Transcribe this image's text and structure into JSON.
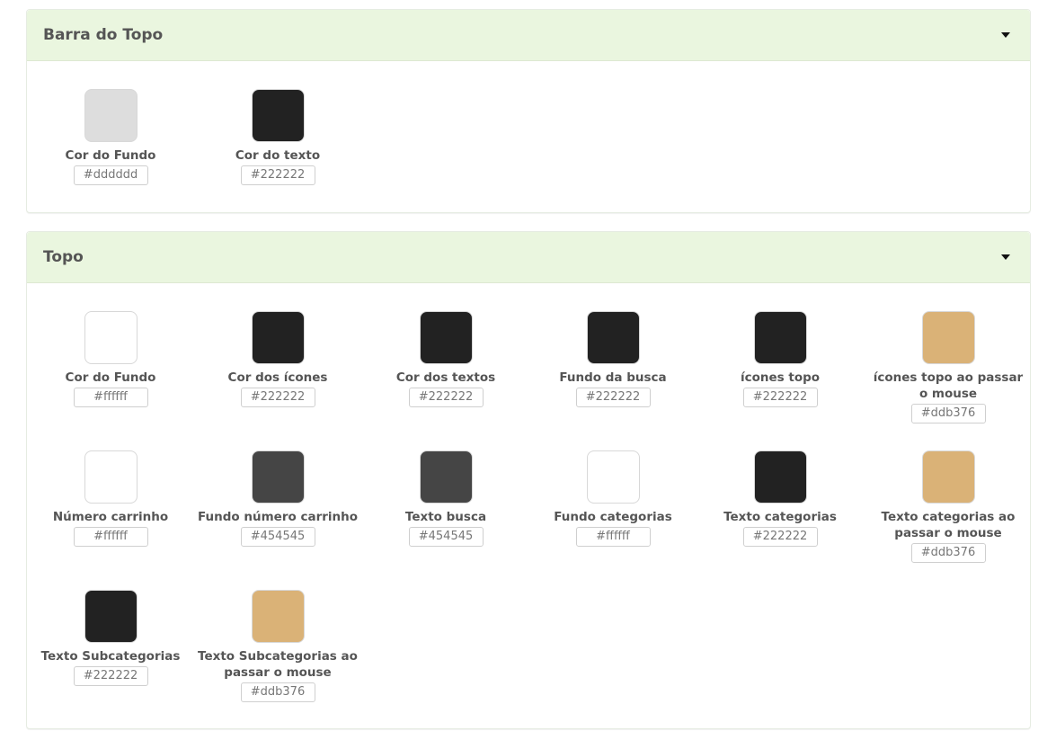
{
  "sections": [
    {
      "title": "Barra do Topo",
      "items": [
        {
          "label": "Cor do Fundo",
          "hex": "#dddddd",
          "color": "#dddddd"
        },
        {
          "label": "Cor do texto",
          "hex": "#222222",
          "color": "#222222"
        }
      ]
    },
    {
      "title": "Topo",
      "items": [
        {
          "label": "Cor do Fundo",
          "hex": "#ffffff",
          "color": "#ffffff"
        },
        {
          "label": "Cor dos ícones",
          "hex": "#222222",
          "color": "#222222"
        },
        {
          "label": "Cor dos textos",
          "hex": "#222222",
          "color": "#222222"
        },
        {
          "label": "Fundo da busca",
          "hex": "#222222",
          "color": "#222222"
        },
        {
          "label": "ícones topo",
          "hex": "#222222",
          "color": "#222222"
        },
        {
          "label": "ícones topo ao passar o mouse",
          "hex": "#ddb376",
          "color": "#dab277"
        },
        {
          "label": "Número carrinho",
          "hex": "#ffffff",
          "color": "#ffffff"
        },
        {
          "label": "Fundo número carrinho",
          "hex": "#454545",
          "color": "#454545"
        },
        {
          "label": "Texto busca",
          "hex": "#454545",
          "color": "#454545"
        },
        {
          "label": "Fundo categorias",
          "hex": "#ffffff",
          "color": "#ffffff"
        },
        {
          "label": "Texto categorias",
          "hex": "#222222",
          "color": "#222222"
        },
        {
          "label": "Texto categorias ao passar o mouse",
          "hex": "#ddb376",
          "color": "#dab277"
        },
        {
          "label": "Texto Subcategorias",
          "hex": "#222222",
          "color": "#222222"
        },
        {
          "label": "Texto Subcategorias ao passar o mouse",
          "hex": "#ddb376",
          "color": "#dab277"
        }
      ]
    }
  ]
}
